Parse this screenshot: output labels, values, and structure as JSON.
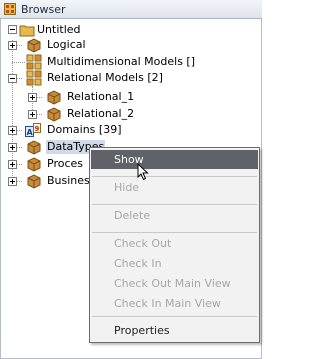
{
  "window": {
    "title": "Browser"
  },
  "tree": {
    "root": "Untitled",
    "items": [
      {
        "label": "Logical"
      },
      {
        "label": "Multidimensional Models []"
      },
      {
        "label": "Relational Models [2]"
      },
      {
        "label": "Relational_1"
      },
      {
        "label": "Relational_2"
      },
      {
        "label": "Domains [39]"
      },
      {
        "label": "DataTypes"
      },
      {
        "label": "Proces"
      },
      {
        "label": "Busines"
      }
    ]
  },
  "context_menu": {
    "items": [
      {
        "label": "Show",
        "enabled": true
      },
      {
        "label": "Hide",
        "enabled": false
      },
      {
        "label": "Delete",
        "enabled": false
      },
      {
        "label": "Check Out",
        "enabled": false
      },
      {
        "label": "Check In",
        "enabled": false
      },
      {
        "label": "Check Out Main View",
        "enabled": false
      },
      {
        "label": "Check In Main View",
        "enabled": false
      },
      {
        "label": "Properties",
        "enabled": true
      }
    ]
  }
}
